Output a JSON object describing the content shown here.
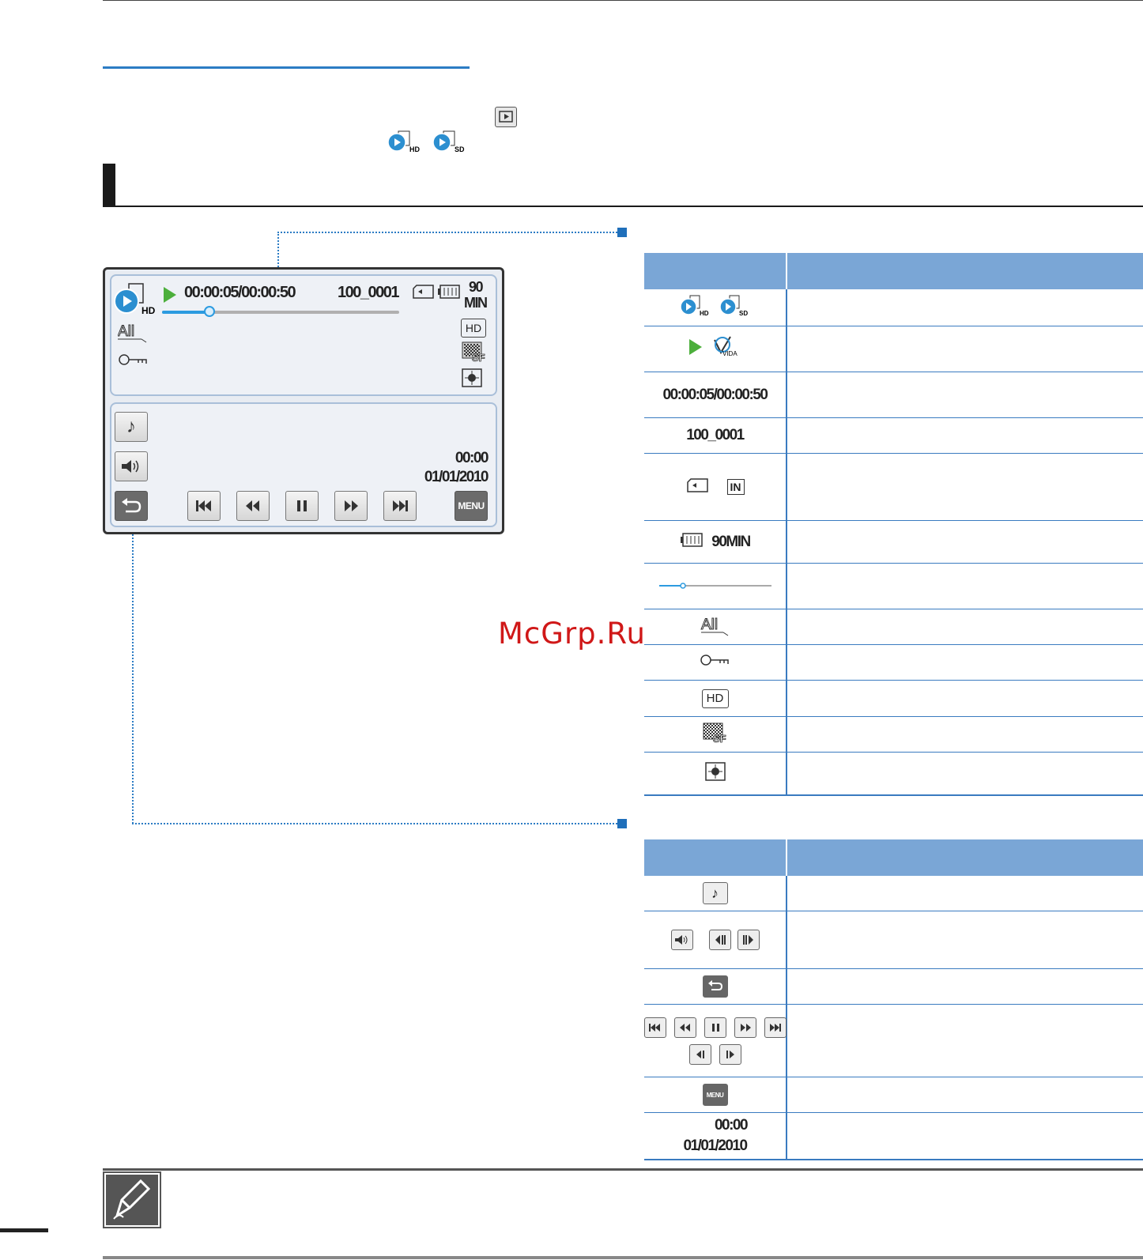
{
  "screen": {
    "timecode": "00:00:05/00:00:50",
    "file_number": "100_0001",
    "battery_time_value": "90",
    "battery_time_unit": "MIN",
    "progress_fraction": 0.2,
    "quality_label": "HD",
    "mode_hd_label": "HD",
    "all_label": "All",
    "clock_time": "00:00",
    "clock_date": "01/01/2010",
    "menu_label": "MENU",
    "music_glyph": "♪"
  },
  "table1": {
    "rows": [
      {
        "icons": [
          "video-play-hd-icon",
          "video-play-sd-icon"
        ]
      },
      {
        "icons": [
          "play-status-icon",
          "vida-icon"
        ]
      },
      {
        "text": "00:00:05/00:00:50"
      },
      {
        "text": "100_0001"
      },
      {
        "icons": [
          "memory-card-icon",
          "internal-memory-icon"
        ],
        "internal_label": "IN"
      },
      {
        "text": "90MIN",
        "icons": [
          "battery-icon"
        ]
      },
      {
        "icons": [
          "progress-bar-icon"
        ]
      },
      {
        "text": "All"
      },
      {
        "icons": [
          "protect-key-icon"
        ]
      },
      {
        "text": "HD"
      },
      {
        "icons": [
          "super-fine-quality-icon"
        ],
        "label": "SF"
      },
      {
        "icons": [
          "anti-shake-icon"
        ]
      }
    ]
  },
  "table2": {
    "rows": [
      {
        "icons": [
          "music-icon"
        ],
        "glyph": "♪"
      },
      {
        "icons": [
          "volume-icon",
          "frame-back-icon",
          "frame-forward-icon"
        ]
      },
      {
        "icons": [
          "return-icon"
        ]
      },
      {
        "icons": [
          "skip-back-icon",
          "rewind-icon",
          "pause-icon",
          "fast-forward-icon",
          "skip-forward-icon",
          "slow-back-icon",
          "slow-forward-icon"
        ]
      },
      {
        "text": "MENU"
      },
      {
        "time": "00:00",
        "date": "01/01/2010"
      }
    ]
  },
  "watermark": "McGrp.Ru",
  "colors": {
    "accent": "#2c7cc4",
    "table_header": "#7aa6d6",
    "play_green": "#4caf3c"
  }
}
